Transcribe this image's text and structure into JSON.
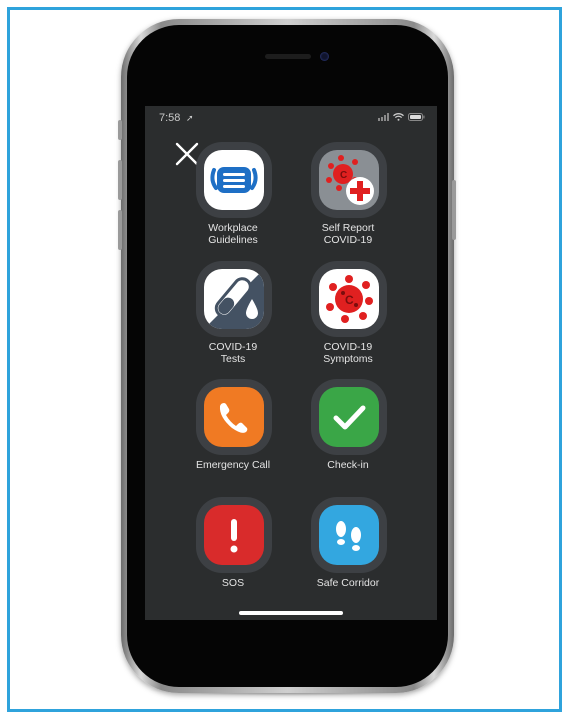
{
  "status": {
    "time": "7:58"
  },
  "tiles": [
    {
      "label_line1": "Workplace",
      "label_line2": "Guidelines",
      "icon": "face-mask-icon",
      "color": "#ffffff"
    },
    {
      "label_line1": "Self Report",
      "label_line2": "COVID-19",
      "icon": "virus-report-icon",
      "color": "#8a8f94"
    },
    {
      "label_line1": "COVID-19",
      "label_line2": "Tests",
      "icon": "test-tube-icon",
      "color": "#ffffff"
    },
    {
      "label_line1": "COVID-19",
      "label_line2": "Symptoms",
      "icon": "virus-icon",
      "color": "#ffffff"
    },
    {
      "label_line1": "Emergency Call",
      "label_line2": "",
      "icon": "phone-icon",
      "color": "#f07a23"
    },
    {
      "label_line1": "Check-in",
      "label_line2": "",
      "icon": "checkmark-icon",
      "color": "#3aa647"
    },
    {
      "label_line1": "SOS",
      "label_line2": "",
      "icon": "exclamation-icon",
      "color": "#d92b2b"
    },
    {
      "label_line1": "Safe Corridor",
      "label_line2": "",
      "icon": "footprints-icon",
      "color": "#33a7e0"
    }
  ]
}
